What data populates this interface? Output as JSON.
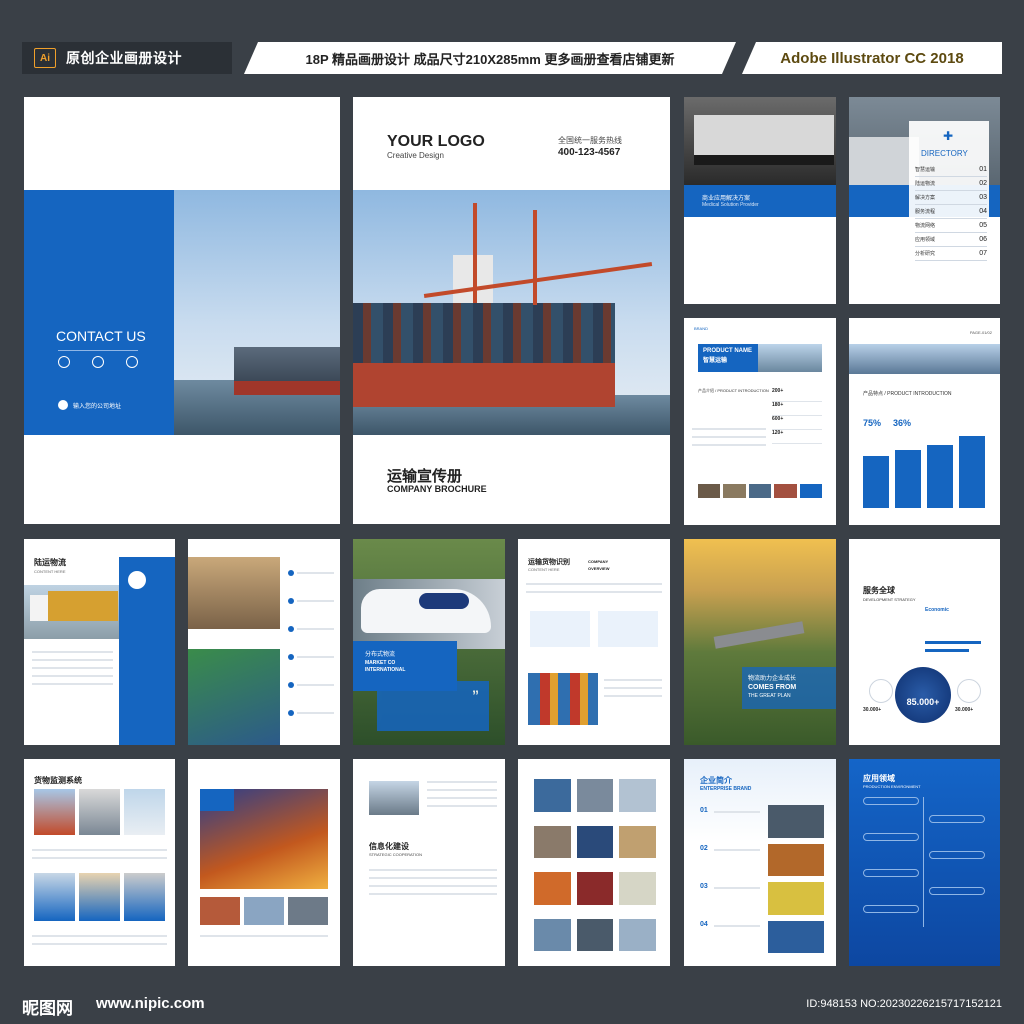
{
  "header": {
    "app_badge": "Ai",
    "left_title": "原创企业画册设计",
    "middle_title": "18P 精品画册设计  成品尺寸210X285mm  更多画册查看店铺更新",
    "right_title": "Adobe Illustrator CC 2018"
  },
  "back_cover": {
    "contact_title": "CONTACT US",
    "address": "输入您的公司地址"
  },
  "front_cover": {
    "logo": "YOUR LOGO",
    "logo_sub": "Creative Design",
    "hotline_label": "全国统一服务热线",
    "hotline": "400-123-4567",
    "title_cn": "运输宣传册",
    "title_en": "COMPANY BROCHURE"
  },
  "pages": {
    "solution_title": "商业应用解决方案",
    "solution_sub": "Medical Solution Provider",
    "directory_title": "DIRECTORY",
    "directory_items": [
      {
        "label": "智慧运输",
        "num": "01"
      },
      {
        "label": "陆运物流",
        "num": "02"
      },
      {
        "label": "解决方案",
        "num": "03"
      },
      {
        "label": "服务流程",
        "num": "04"
      },
      {
        "label": "物流网络",
        "num": "05"
      },
      {
        "label": "应用领域",
        "num": "06"
      },
      {
        "label": "分析研究",
        "num": "07"
      }
    ],
    "brand_label": "BRAND",
    "product_name": "PRODUCT NAME",
    "product_cn": "智慧运输",
    "product_intro": "产品介绍 / PRODUCT INTRODUCTION",
    "product_stats": [
      "200+",
      "180+",
      "600+",
      "120+"
    ],
    "page_num": "PAGE-01/02",
    "features_title": "产品特点 / PRODUCT INTRODUCTION",
    "percent_a": "75%",
    "percent_b": "36%",
    "land_title": "陆运物流",
    "land_sub": "CONTENT HERE",
    "train_cn": "分布式物流",
    "train_en": "MARKET CO",
    "train_en2": "INTERNATIONAL",
    "identify_title": "运输货物识别",
    "identify_sub": "CONTENT HERE",
    "overview": "COMPANY",
    "overview2": "OVERVIEW",
    "growth_cn": "物流助力企业成长",
    "growth_en": "COMES FROM",
    "growth_en2": "THE GREAT PLAN",
    "global_title": "服务全球",
    "global_sub": "DEVELOPMENT STRATEGY",
    "economic": "Economic",
    "big_stat": "85.000+",
    "side_stat_a": "30.000+",
    "side_stat_b": "30.000+",
    "monitor_title": "货物监测系统",
    "info_title": "信息化建设",
    "info_sub": "STRATEGIC COOPERATION",
    "enterprise_title": "企业简介",
    "enterprise_sub": "ENTERPRISE BRAND",
    "enterprise_nums": [
      "01",
      "02",
      "03",
      "04"
    ],
    "app_title": "应用领域",
    "app_sub": "PRODUCTION ENVIRONMENT"
  },
  "footer": {
    "site_logo": "昵图网",
    "site_url": "www.nipic.com",
    "image_id": "ID:948153 NO:20230226215717152121"
  },
  "colors": {
    "accent_blue": "#1565c0",
    "background": "#3a4047"
  }
}
